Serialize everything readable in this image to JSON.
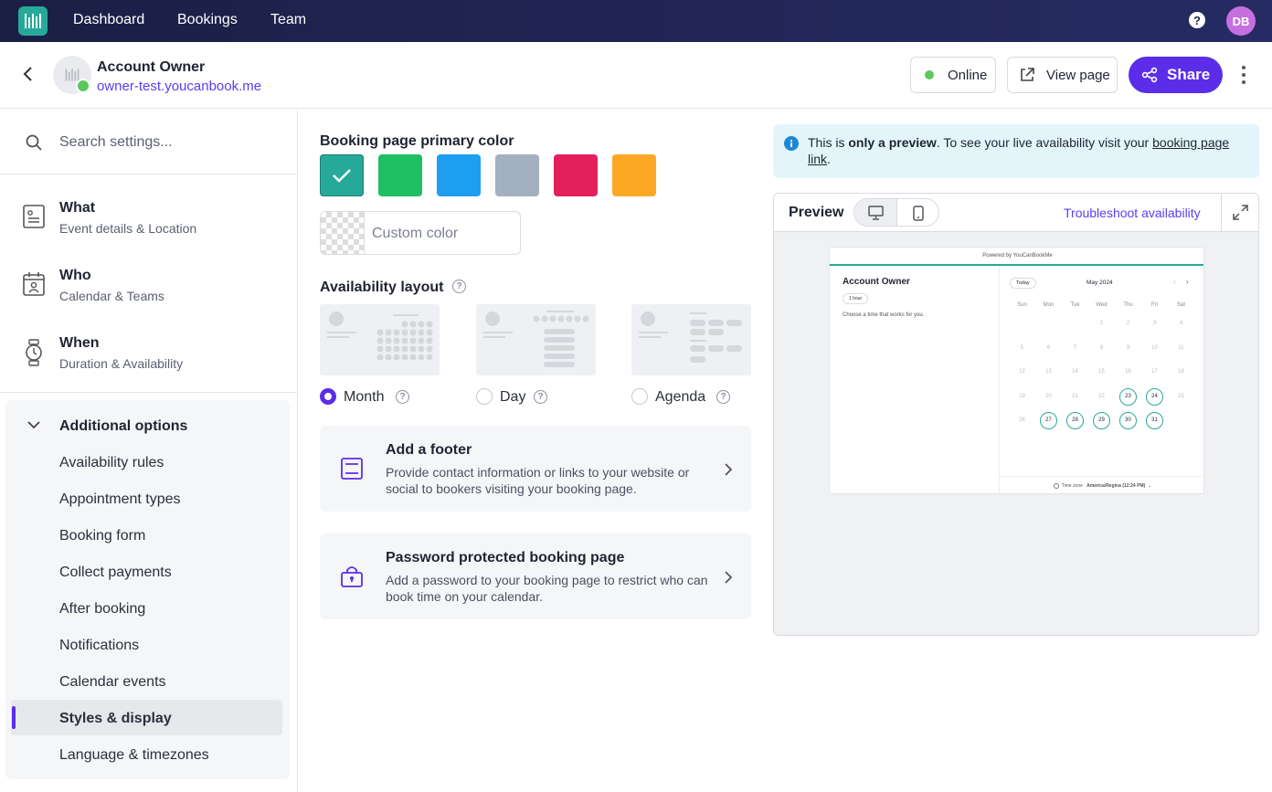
{
  "topnav": {
    "links": [
      "Dashboard",
      "Bookings",
      "Team"
    ],
    "help_label": "?",
    "avatar_initials": "DB",
    "brand_color": "#27a99a"
  },
  "header": {
    "account_name": "Account Owner",
    "account_url": "owner-test.youcanbook.me",
    "online_label": "Online",
    "view_page_label": "View page",
    "share_label": "Share",
    "accent_color": "#5b2de8"
  },
  "sidebar": {
    "search_placeholder": "Search settings...",
    "sections": [
      {
        "title": "What",
        "subtitle": "Event details & Location",
        "icon": "document-icon"
      },
      {
        "title": "Who",
        "subtitle": "Calendar & Teams",
        "icon": "calendar-person-icon"
      },
      {
        "title": "When",
        "subtitle": "Duration & Availability",
        "icon": "watch-icon"
      }
    ],
    "additional": {
      "heading": "Additional options",
      "items": [
        "Availability rules",
        "Appointment types",
        "Booking form",
        "Collect payments",
        "After booking",
        "Notifications",
        "Calendar events",
        "Styles & display",
        "Language & timezones"
      ],
      "active_index": 7
    }
  },
  "main": {
    "color_heading": "Booking page primary color",
    "colors": [
      "#27a99a",
      "#1fbf63",
      "#1e9ef0",
      "#a3b0bf",
      "#e31f5c",
      "#fda823"
    ],
    "selected_color_index": 0,
    "custom_color_placeholder": "Custom color",
    "layout_heading": "Availability layout",
    "layouts": [
      "Month",
      "Day",
      "Agenda"
    ],
    "selected_layout_index": 0,
    "cards": [
      {
        "title": "Add a footer",
        "description": "Provide contact information or links to your website or social to bookers visiting your booking page.",
        "icon": "footer-icon"
      },
      {
        "title": "Password protected booking page",
        "description": "Add a password to your booking page to restrict who can book time on your calendar.",
        "icon": "lock-icon"
      }
    ]
  },
  "preview": {
    "info_prefix": "This is ",
    "info_bold": "only a preview",
    "info_mid": ". To see your live availability visit your ",
    "info_link": "booking page link",
    "info_end": ".",
    "title": "Preview",
    "troubleshoot_label": "Troubleshoot availability",
    "mini": {
      "powered": "Powered by YouCanBookMe",
      "name": "Account Owner",
      "duration": "1 hour",
      "choose": "Choose a time that works for you.",
      "today": "Today",
      "month": "May 2024",
      "weekdays": [
        "Sun",
        "Mon",
        "Tue",
        "Wed",
        "Thu",
        "Fri",
        "Sat"
      ],
      "weeks": [
        [
          "",
          "",
          "",
          "1",
          "2",
          "3",
          "4"
        ],
        [
          "5",
          "6",
          "7",
          "8",
          "9",
          "10",
          "11"
        ],
        [
          "12",
          "13",
          "14",
          "15",
          "16",
          "17",
          "18"
        ],
        [
          "19",
          "20",
          "21",
          "22",
          "23",
          "24",
          "25"
        ],
        [
          "26",
          "27",
          "28",
          "29",
          "30",
          "31",
          ""
        ]
      ],
      "available_days": [
        "23",
        "24",
        "27",
        "28",
        "29",
        "30",
        "31"
      ],
      "tz_label": "Time zone",
      "tz_value": "America/Regina (12:24 PM)"
    }
  }
}
